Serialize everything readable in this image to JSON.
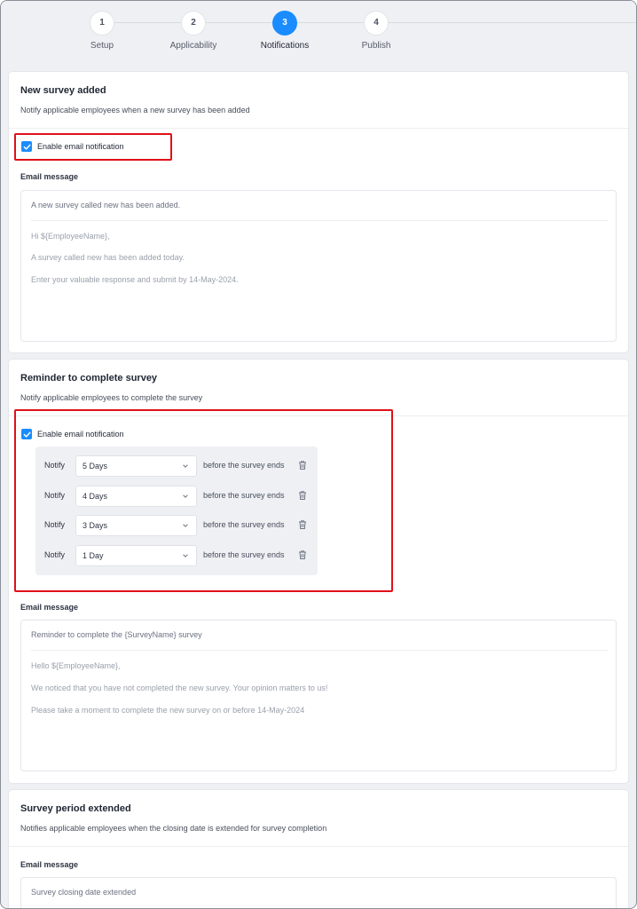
{
  "stepper": {
    "steps": [
      {
        "number": "1",
        "label": "Setup"
      },
      {
        "number": "2",
        "label": "Applicability"
      },
      {
        "number": "3",
        "label": "Notifications"
      },
      {
        "number": "4",
        "label": "Publish"
      }
    ],
    "active_step": "3"
  },
  "colors": {
    "accent": "#1a8cff",
    "highlight_border": "#e0101a",
    "page_bg": "#eef0f4"
  },
  "new_survey": {
    "title": "New survey added",
    "description": "Notify applicable employees when a new survey has been added",
    "enable_label": "Enable email notification",
    "enabled": true,
    "email_label": "Email message",
    "subject": "A new survey called new has been added.",
    "body": [
      "Hi ${EmployeeName},",
      "A survey called new has been added today.",
      "Enter your valuable response and submit by 14-May-2024."
    ]
  },
  "reminder": {
    "title": "Reminder to complete survey",
    "description": "Notify applicable employees to complete the survey",
    "enable_label": "Enable email notification",
    "enabled": true,
    "rows": [
      {
        "notify": "Notify",
        "value": "5 Days",
        "after": "before the survey ends"
      },
      {
        "notify": "Notify",
        "value": "4 Days",
        "after": "before the survey ends"
      },
      {
        "notify": "Notify",
        "value": "3 Days",
        "after": "before the survey ends"
      },
      {
        "notify": "Notify",
        "value": "1 Day",
        "after": "before the survey ends"
      }
    ],
    "email_label": "Email message",
    "subject": "Reminder to complete the {SurveyName} survey",
    "body": [
      "Hello ${EmployeeName},",
      "We noticed that you have not completed the new survey. Your opinion matters to us!",
      "Please take a moment to complete the new survey on or before 14-May-2024"
    ]
  },
  "extended": {
    "title": "Survey period extended",
    "description": "Notifies applicable employees when the closing date is extended for survey completion",
    "email_label": "Email message",
    "subject": "Survey closing date extended"
  }
}
